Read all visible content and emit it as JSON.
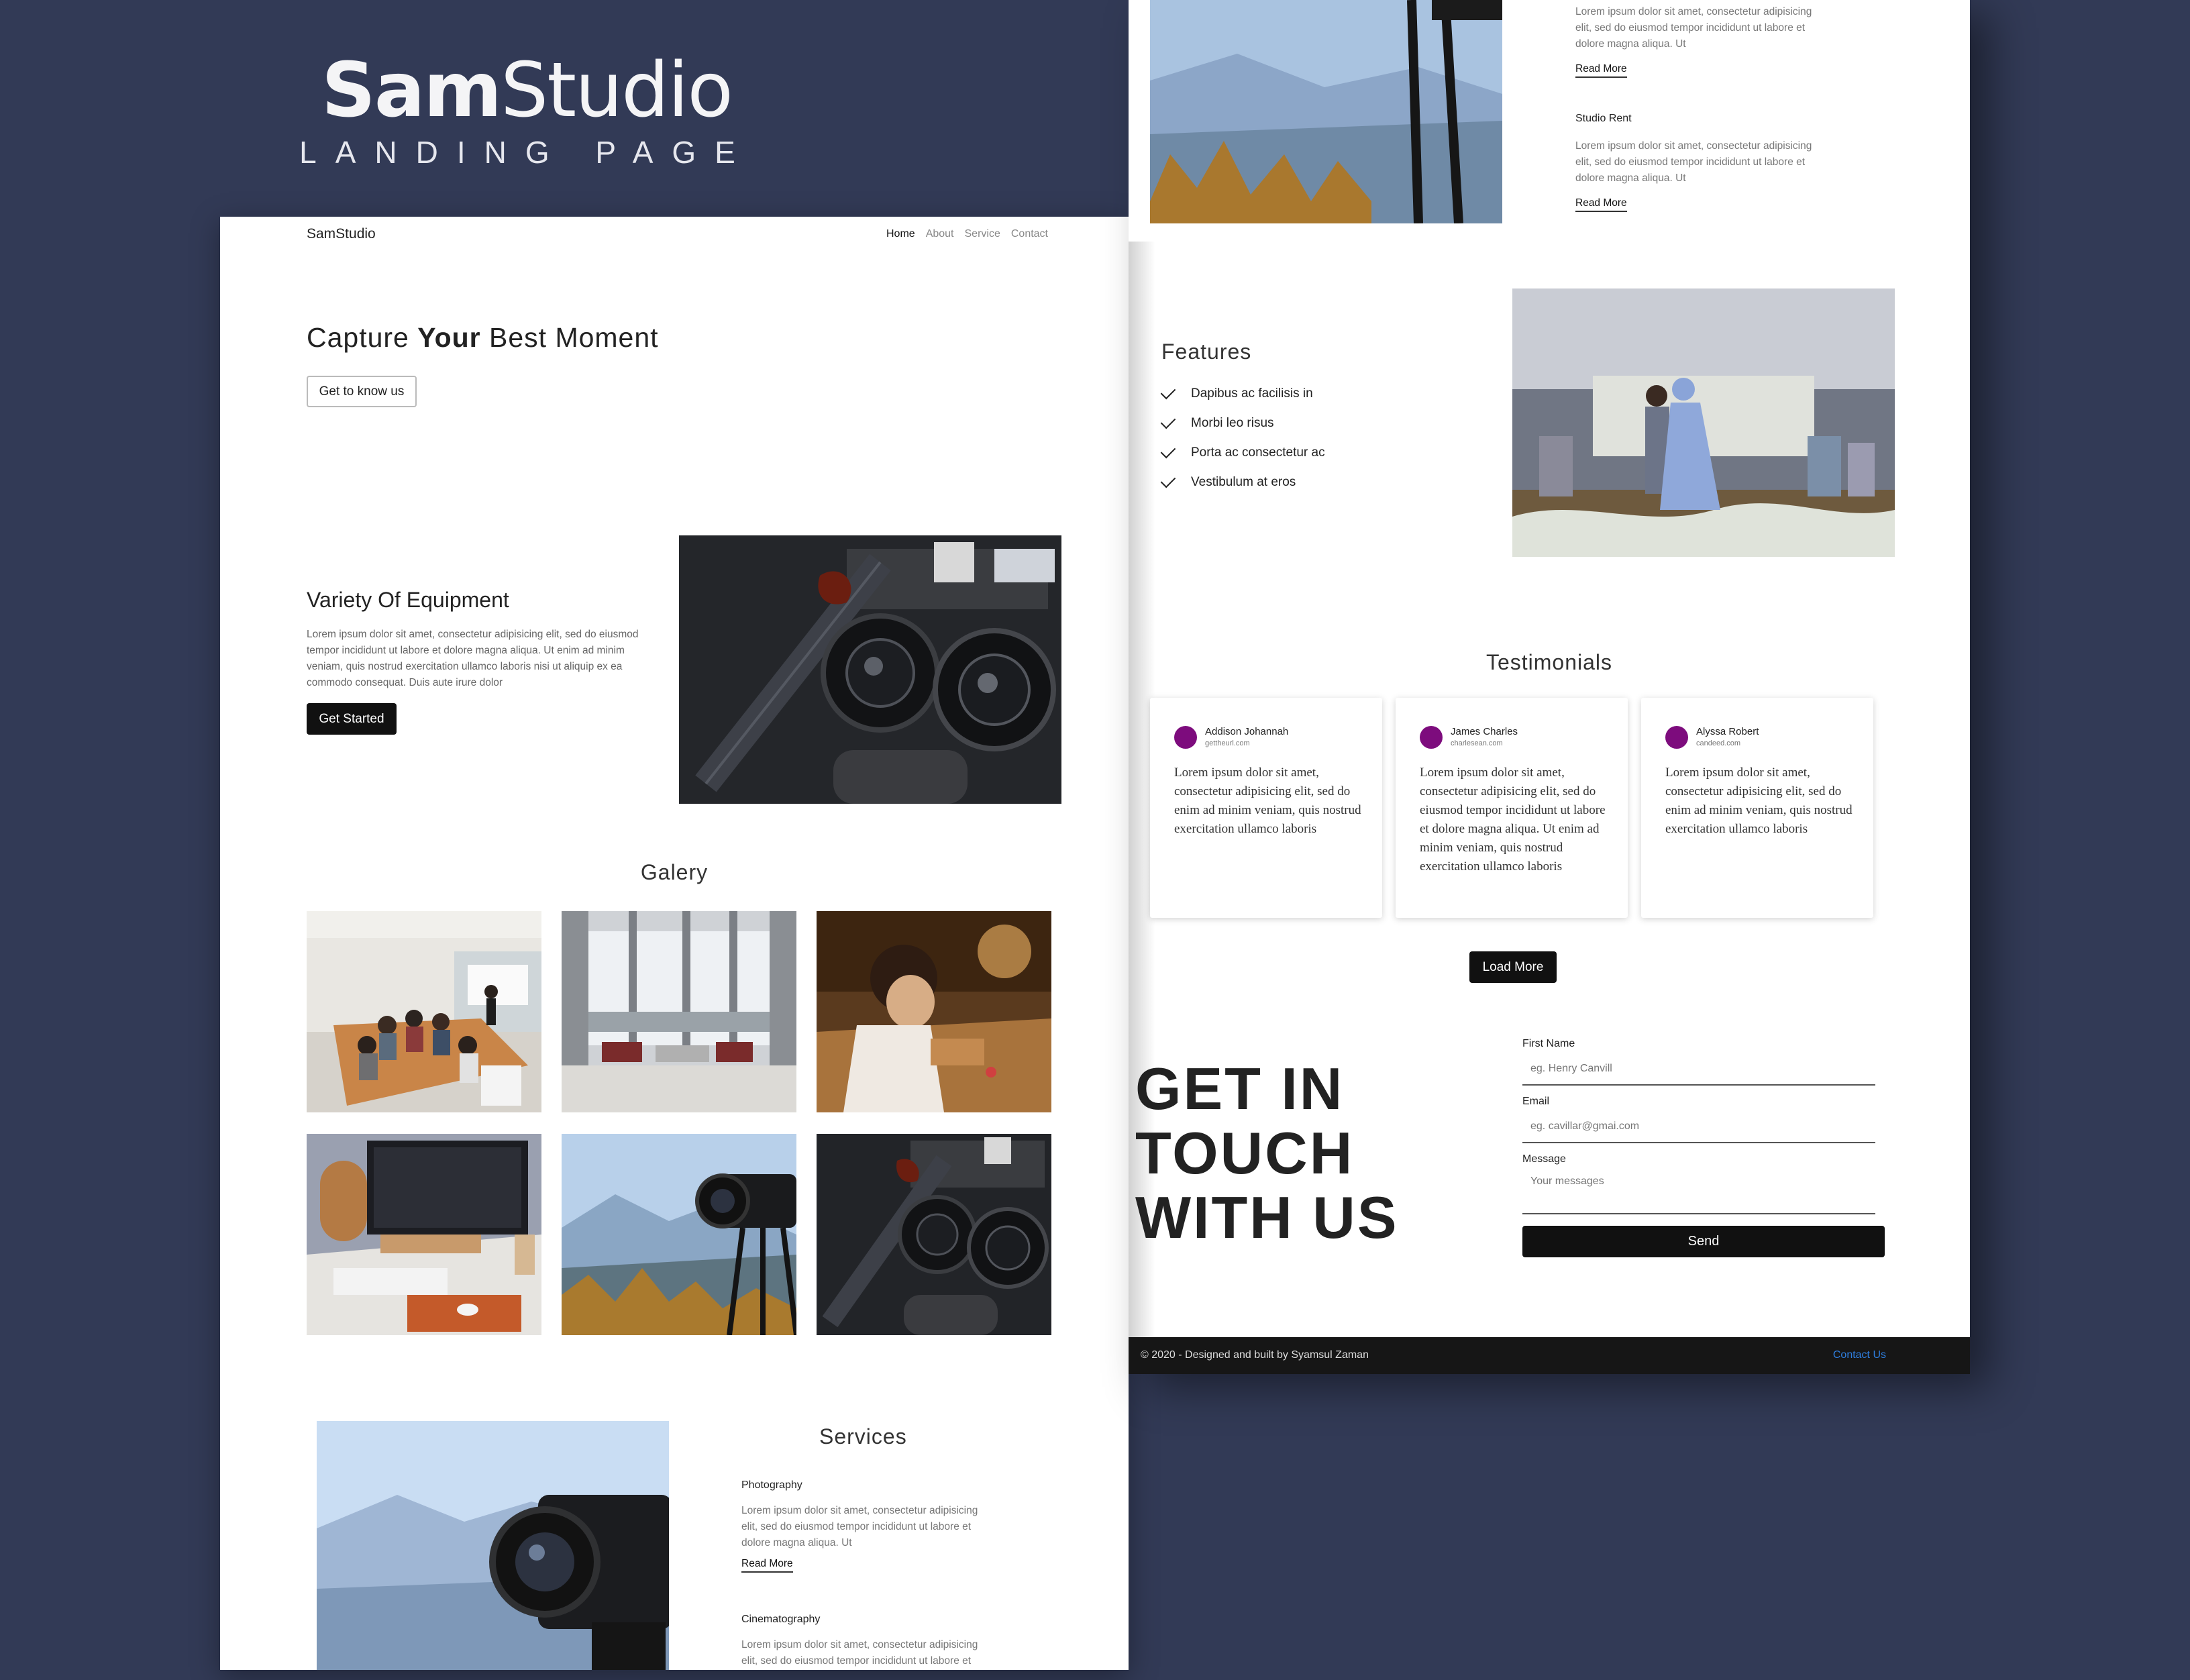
{
  "brand": {
    "logo_bold": "Sam",
    "logo_light": "Studio",
    "subtitle": "LANDING PAGE"
  },
  "nav": {
    "brand": "SamStudio",
    "links": [
      "Home",
      "About",
      "Service",
      "Contact"
    ]
  },
  "hero": {
    "title_pre": "Capture ",
    "title_bold": "Your",
    "title_post": " Best Moment",
    "button": "Get to know us"
  },
  "equipment": {
    "title": "Variety Of Equipment",
    "text": "Lorem ipsum dolor sit amet, consectetur adipisicing elit, sed do eiusmod tempor incididunt ut labore et dolore magna aliqua. Ut enim ad minim veniam, quis nostrud exercitation ullamco laboris nisi ut aliquip ex ea commodo consequat. Duis aute irure dolor",
    "button": "Get Started"
  },
  "gallery": {
    "title": "Galery"
  },
  "services": {
    "title": "Services",
    "items": [
      {
        "name": "Photography",
        "text": "Lorem ipsum dolor sit amet, consectetur adipisicing elit, sed do eiusmod tempor incididunt ut labore et dolore magna aliqua. Ut",
        "link": "Read More"
      },
      {
        "name": "Cinematography",
        "text": "Lorem ipsum dolor sit amet, consectetur adipisicing elit, sed do eiusmod tempor incididunt ut labore et"
      },
      {
        "text": "Lorem ipsum dolor sit amet, consectetur adipisicing elit, sed do eiusmod tempor incididunt ut labore et dolore magna aliqua. Ut",
        "link": "Read More"
      },
      {
        "name": "Studio Rent",
        "text": "Lorem ipsum dolor sit amet, consectetur adipisicing elit, sed do eiusmod tempor incididunt ut labore et dolore magna aliqua. Ut",
        "link": "Read More"
      }
    ]
  },
  "features": {
    "title": "Features",
    "items": [
      "Dapibus ac facilisis in",
      "Morbi leo risus",
      "Porta ac consectetur ac",
      "Vestibulum at eros"
    ]
  },
  "testimonials": {
    "title": "Testimonials",
    "items": [
      {
        "name": "Addison Johannah",
        "site": "gettheurl.com",
        "text": "Lorem ipsum dolor sit amet, consectetur adipisicing elit, sed do enim ad minim veniam, quis nostrud exercitation ullamco laboris"
      },
      {
        "name": "James Charles",
        "site": "charlesean.com",
        "text": "Lorem ipsum dolor sit amet, consectetur adipisicing elit, sed do eiusmod tempor incididunt ut labore et dolore magna aliqua. Ut enim ad minim veniam, quis nostrud exercitation ullamco laboris"
      },
      {
        "name": "Alyssa Robert",
        "site": "candeed.com",
        "text": "Lorem ipsum dolor sit amet, consectetur adipisicing elit, sed do enim ad minim veniam, quis nostrud exercitation ullamco laboris"
      }
    ],
    "button": "Load More"
  },
  "contact": {
    "heading": [
      "GET IN",
      "TOUCH",
      "WITH US"
    ],
    "first_name_label": "First Name",
    "first_name_placeholder": "eg. Henry Canvill",
    "email_label": "Email",
    "email_placeholder": "eg. cavillar@gmai.com",
    "message_label": "Message",
    "message_placeholder": "Your messages",
    "send": "Send"
  },
  "footer": {
    "copy": "© 2020 - Designed and built by Syamsul Zaman",
    "link": "Contact Us"
  },
  "colors": {
    "background": "#323a56",
    "avatar": "#7d0c7d",
    "link": "#2f7fe0",
    "dark_button": "#111111"
  }
}
